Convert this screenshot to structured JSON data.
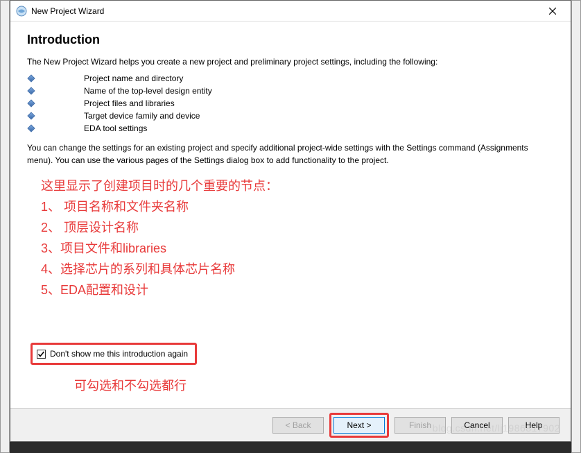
{
  "titlebar": {
    "title": "New Project Wizard"
  },
  "content": {
    "heading": "Introduction",
    "intro": "The New Project Wizard helps you create a new project and preliminary project settings, including the following:",
    "bullets": [
      "Project name and directory",
      "Name of the top-level design entity",
      "Project files and libraries",
      "Target device family and device",
      "EDA tool settings"
    ],
    "outro": "You can change the settings for an existing project and specify additional project-wide settings with the Settings command (Assignments menu). You can use the various pages of the Settings dialog box to add functionality to the project."
  },
  "annotation": {
    "title": "这里显示了创建项目时的几个重要的节点：",
    "items": [
      "1、 项目名称和文件夹名称",
      "2、 顶层设计名称",
      "3、项目文件和libraries",
      "4、选择芯片的系列和具体芯片名称",
      "5、EDA配置和设计"
    ],
    "checkbox_note": "可勾选和不勾选都行"
  },
  "checkbox": {
    "label": "Don't show me this introduction again",
    "checked": true
  },
  "footer": {
    "back": "< Back",
    "next": "Next >",
    "finish": "Finish",
    "cancel": "Cancel",
    "help": "Help"
  },
  "watermark": "blog.csdn.net/lj1986817902"
}
